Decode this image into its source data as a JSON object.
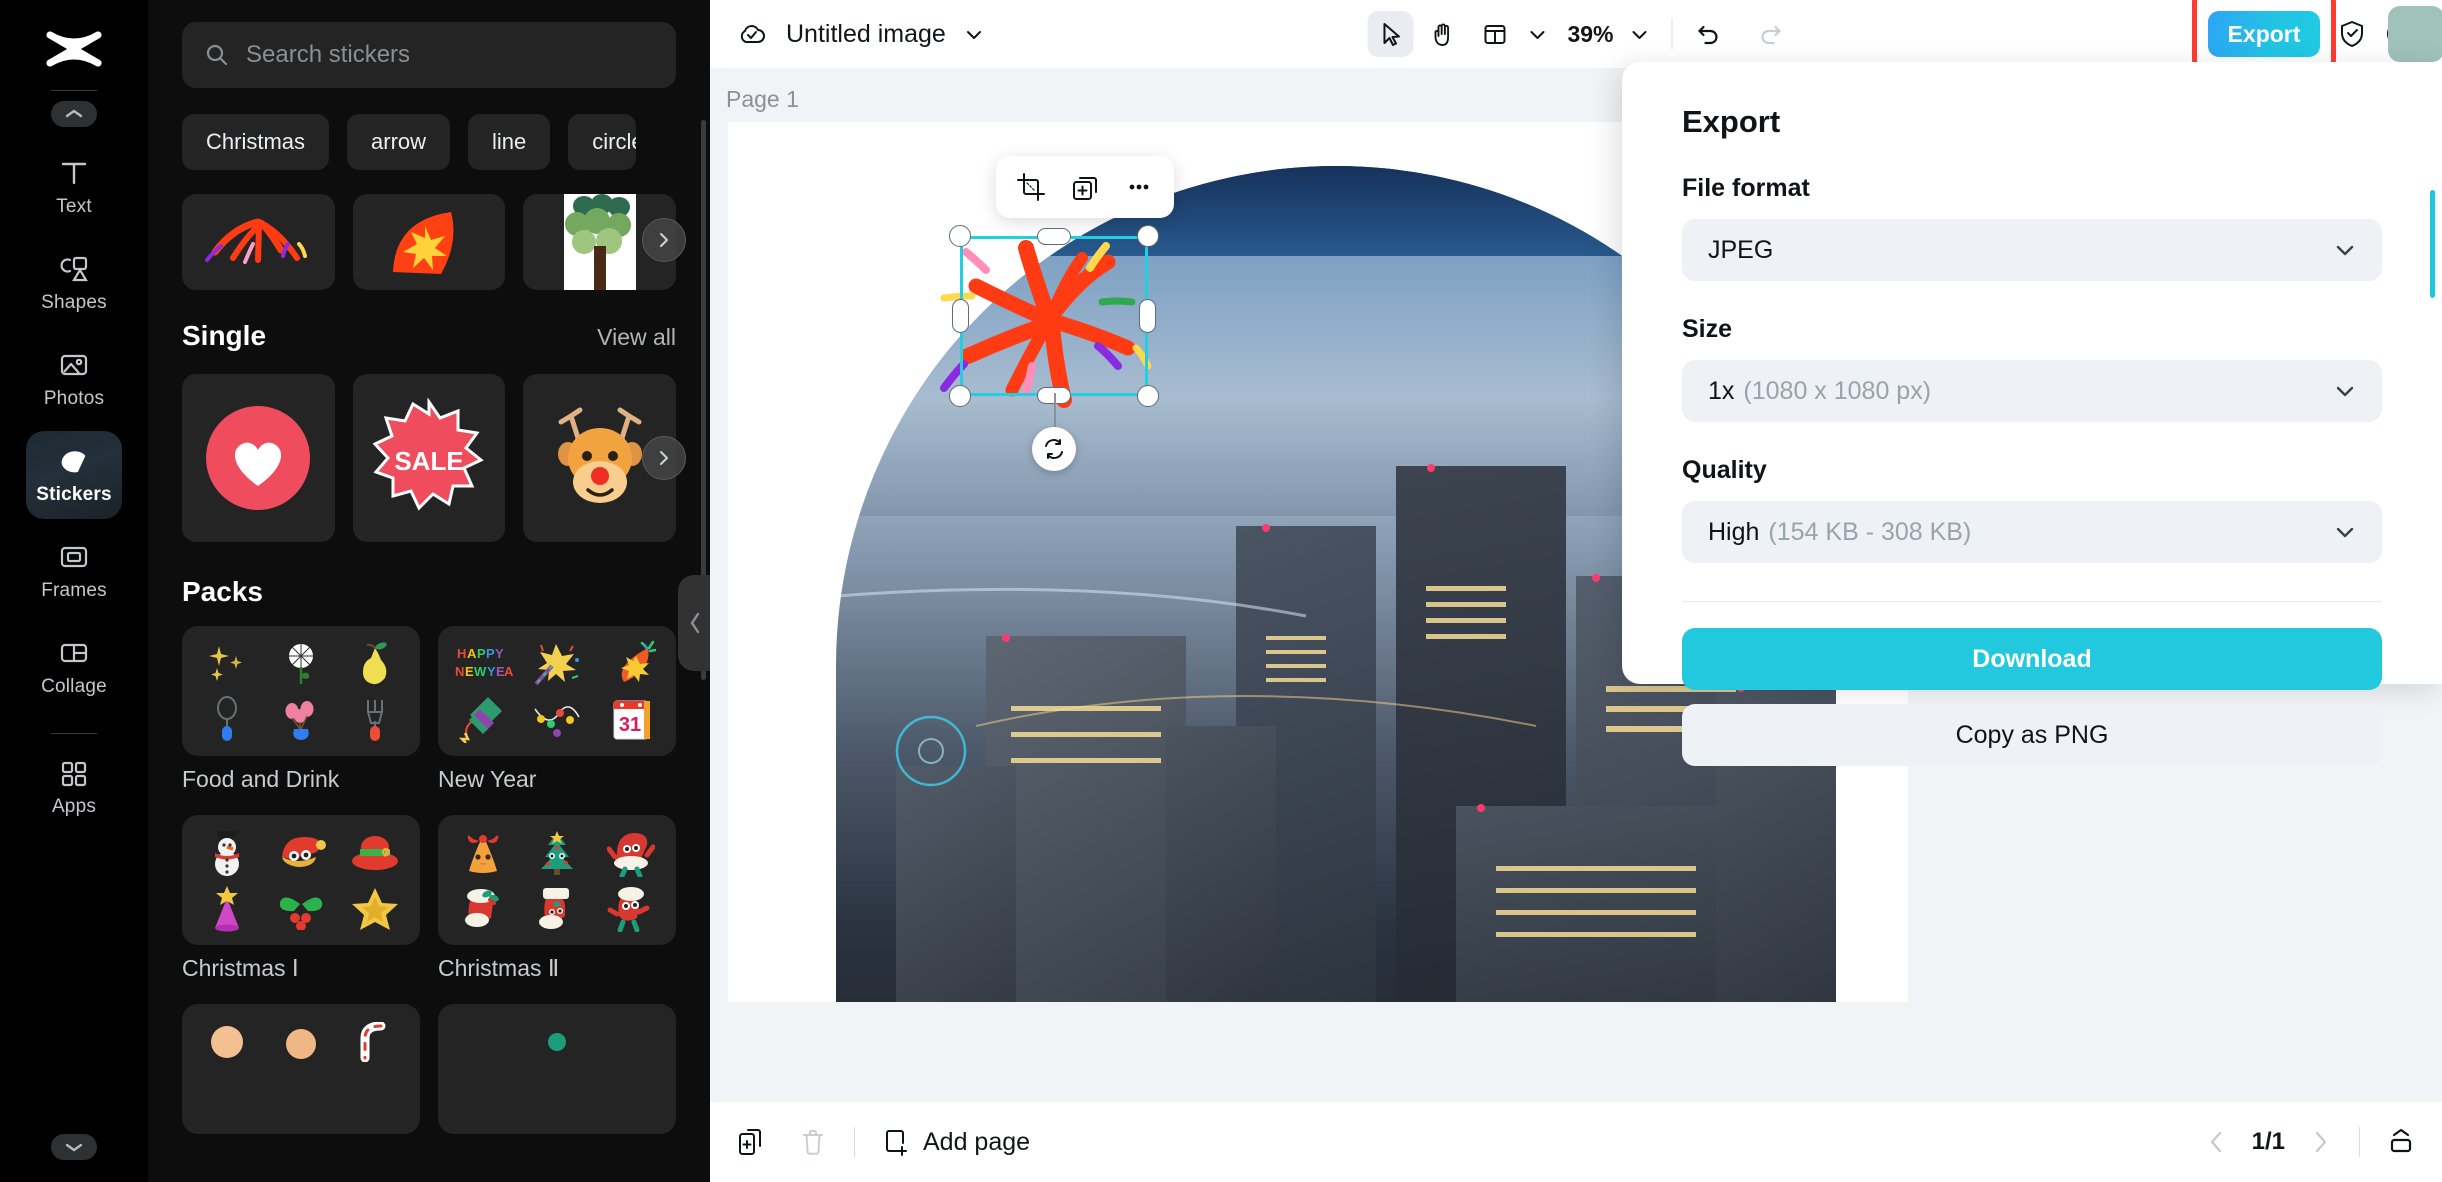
{
  "rail": {
    "logo": "capcut-logo",
    "collapse_up": "chevron-up-icon",
    "collapse_down": "chevron-down-icon",
    "items": [
      {
        "label": "Text",
        "icon": "text-icon",
        "active": false
      },
      {
        "label": "Shapes",
        "icon": "shapes-icon",
        "active": false
      },
      {
        "label": "Photos",
        "icon": "photos-icon",
        "active": false
      },
      {
        "label": "Stickers",
        "icon": "stickers-icon",
        "active": true
      },
      {
        "label": "Frames",
        "icon": "frames-icon",
        "active": false
      },
      {
        "label": "Collage",
        "icon": "collage-icon",
        "active": false
      },
      {
        "label": "Apps",
        "icon": "apps-icon",
        "active": false
      }
    ]
  },
  "stickers_panel": {
    "search": {
      "placeholder": "Search stickers",
      "icon": "search-icon",
      "value": ""
    },
    "chips": [
      "Christmas",
      "arrow",
      "line",
      "circle"
    ],
    "recent_tiles": [
      "firework-burst-sticker",
      "orange-star-burst-sticker",
      "green-tree-sticker"
    ],
    "single": {
      "title": "Single",
      "view_all": "View all",
      "tiles": [
        "white-heart-red-circle-sticker",
        "sale-starburst-sticker",
        "reindeer-face-sticker"
      ],
      "next_icon": "chevron-right-icon"
    },
    "packs": {
      "title": "Packs",
      "items": [
        {
          "label": "Food and Drink"
        },
        {
          "label": "New Year"
        },
        {
          "label": "Christmas Ⅰ"
        },
        {
          "label": "Christmas Ⅱ"
        }
      ]
    },
    "collapse_handle_icon": "chevron-left-icon"
  },
  "topbar": {
    "cloud_status_icon": "cloud-check-icon",
    "doc_title": "Untitled image",
    "doc_title_chevron": "chevron-down-icon",
    "tools": [
      {
        "name": "select-tool",
        "icon": "cursor-icon",
        "active": true
      },
      {
        "name": "hand-tool",
        "icon": "hand-icon",
        "active": false
      },
      {
        "name": "layout-tool",
        "icon": "layout-icon",
        "active": false
      }
    ],
    "layout_chevron": "chevron-down-icon",
    "zoom": "39%",
    "zoom_chevron": "chevron-down-icon",
    "undo_icon": "undo-icon",
    "redo_icon": "redo-icon",
    "export_label": "Export",
    "shield_icon": "shield-check-icon",
    "help_icon": "help-circle-icon",
    "highlight_color": "#ff3b30",
    "export_gradient_from": "#2ca5f5",
    "export_gradient_to": "#1ecbe1"
  },
  "canvas": {
    "page_label": "Page 1",
    "float_toolbar": [
      {
        "name": "crop-button",
        "icon": "crop-icon"
      },
      {
        "name": "duplicate-button",
        "icon": "duplicate-plus-icon"
      },
      {
        "name": "more-button",
        "icon": "more-horizontal-icon"
      }
    ],
    "selection": {
      "handle_color": "#21cfe0",
      "rotate_icon": "rotate-icon"
    },
    "artwork": "aerial-city-at-dusk-photo-in-arch-frame",
    "sticker": "orange-firework-burst-sticker"
  },
  "export_panel": {
    "title": "Export",
    "file_format": {
      "label": "File format",
      "value": "JPEG",
      "chevron": "chevron-down-icon"
    },
    "size": {
      "label": "Size",
      "value": "1x",
      "detail": "(1080 x 1080 px)",
      "chevron": "chevron-down-icon"
    },
    "quality": {
      "label": "Quality",
      "value": "High",
      "detail": "(154 KB - 308 KB)",
      "chevron": "chevron-down-icon"
    },
    "download_label": "Download",
    "copy_label": "Copy as PNG",
    "accent_color": "#22c8dd"
  },
  "bottombar": {
    "duplicate_page_icon": "duplicate-page-icon",
    "delete_page_icon": "trash-icon",
    "add_page_icon": "add-page-icon",
    "add_page_label": "Add page",
    "prev_icon": "chevron-left-icon",
    "page_indicator": "1/1",
    "next_icon": "chevron-right-icon",
    "expand_icon": "panel-expand-icon"
  }
}
